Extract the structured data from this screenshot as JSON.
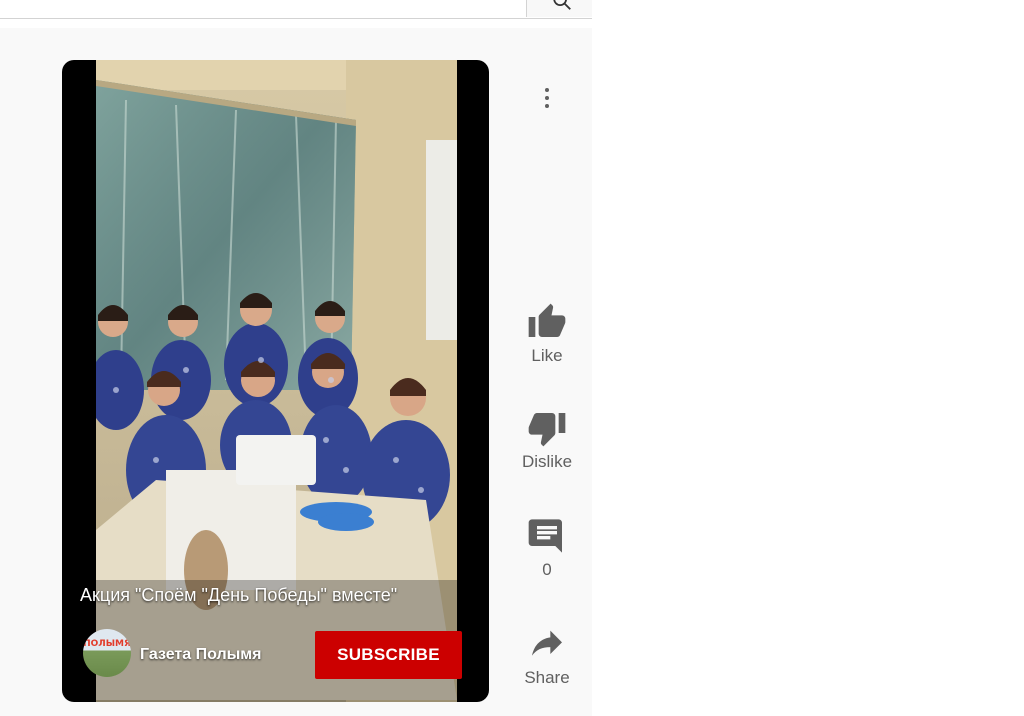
{
  "video": {
    "title": "Акция \"Споём \"День Победы\" вместе\"",
    "channel_name": "Газета Полымя",
    "channel_logo_text": "ПОЛЫМЯ",
    "subscribe_label": "SUBSCRIBE"
  },
  "actions": {
    "like_label": "Like",
    "dislike_label": "Dislike",
    "comments_count": "0",
    "share_label": "Share"
  },
  "colors": {
    "subscribe_bg": "#cc0000",
    "icon": "#606060",
    "page_bg": "#f9f9f9"
  },
  "icons": [
    "search-icon",
    "more-vertical-icon",
    "thumb-up-icon",
    "thumb-down-icon",
    "comment-icon",
    "share-icon"
  ]
}
